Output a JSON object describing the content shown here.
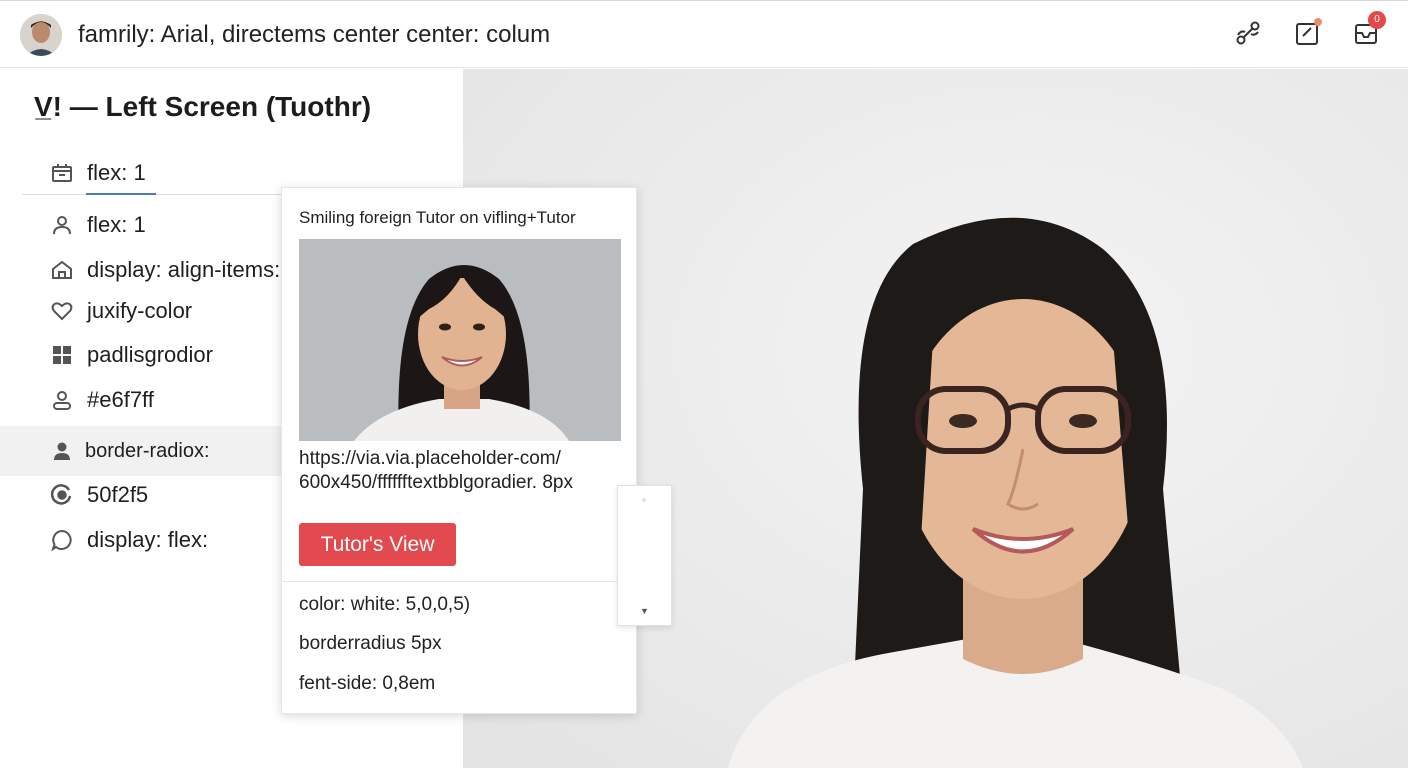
{
  "header": {
    "title": "famrily: Arial, directems center center: colum",
    "icons": [
      "share-route-icon",
      "edit-note-icon",
      "inbox-icon"
    ],
    "inbox_badge": "0"
  },
  "sidebar": {
    "title": "V̲! — Left Screen (Tuothr)",
    "items": [
      {
        "label": "flex: 1",
        "icon": "calendar-icon"
      },
      {
        "label": "flex: 1",
        "icon": "user-icon"
      },
      {
        "label": "display: align-items:",
        "icon": "home-icon"
      },
      {
        "label": "juxify-color",
        "icon": "heart-icon"
      },
      {
        "label": "padlisgrodior",
        "icon": "grid-icon"
      },
      {
        "label": "#e6f7ff",
        "icon": "person-icon"
      },
      {
        "label": "border-radiox:",
        "icon": "person-filled-icon"
      },
      {
        "label": "50f2f5",
        "icon": "target-icon"
      },
      {
        "label": "display: flex:",
        "icon": "chat-icon"
      }
    ]
  },
  "card": {
    "caption": "Smiling foreign Tutor on vifling+Tutor",
    "url_line1": "https://via.via.placeholder-com/",
    "url_line2": "600x450/fffffftextbblgoradier. 8px",
    "button_label": "Tutor's View",
    "lines": [
      "color: white: 5,0,0,5)",
      "borderradius 5px",
      "fent-side: 0,8em"
    ]
  },
  "colors": {
    "accent_red": "#e24a4f",
    "active_underline": "#4a7ab8",
    "badge_red": "#e54848"
  }
}
